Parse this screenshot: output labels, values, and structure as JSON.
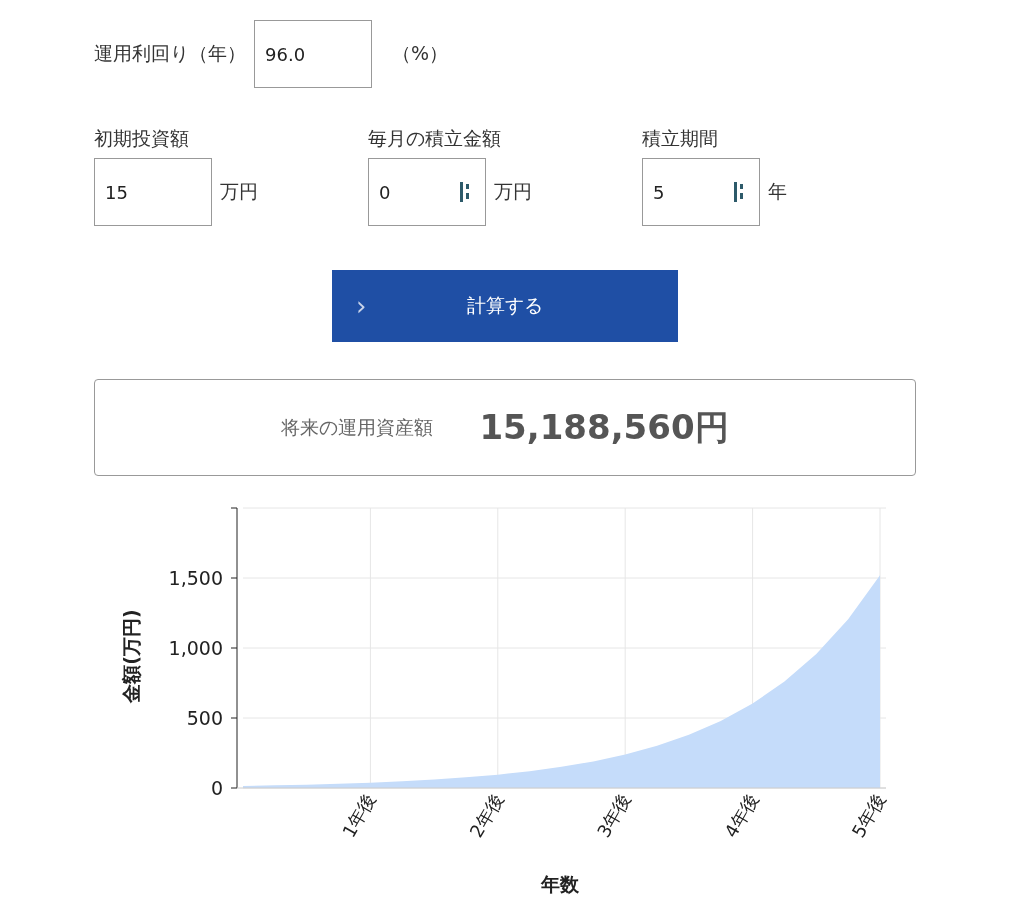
{
  "rate": {
    "label": "運用利回り（年）",
    "value": "96.0",
    "unit": "（%）"
  },
  "fields": [
    {
      "label": "初期投資額",
      "value": "15",
      "unit": "万円",
      "kind": "plain"
    },
    {
      "label": "毎月の積立金額",
      "value": "0",
      "unit": "万円",
      "kind": "spinner"
    },
    {
      "label": "積立期間",
      "value": "5",
      "unit": "年",
      "kind": "spinner"
    }
  ],
  "button": {
    "icon": "›",
    "label": "計算する"
  },
  "result": {
    "label": "将来の運用資産額",
    "value": "15,188,560円"
  },
  "chart": {
    "chart_data": {
      "type": "area",
      "xlabel": "年数",
      "ylabel": "金額(万円)",
      "x": [
        0,
        0.25,
        0.5,
        0.75,
        1,
        1.25,
        1.5,
        1.75,
        2,
        2.25,
        2.5,
        2.75,
        3,
        3.25,
        3.5,
        3.75,
        4,
        4.25,
        4.5,
        4.75,
        5
      ],
      "series": [
        {
          "color": "#c5dcfa",
          "values": [
            15,
            19,
            24,
            30,
            38,
            48,
            60,
            76,
            95,
            120,
            151,
            190,
            240,
            302,
            380,
            479,
            603,
            760,
            957,
            1206,
            1519
          ]
        }
      ],
      "grid": true,
      "xlim": [
        0,
        5
      ],
      "ylim": [
        0,
        2000
      ],
      "xticks": [
        {
          "value": 1,
          "label": "1年後"
        },
        {
          "value": 2,
          "label": "2年後"
        },
        {
          "value": 3,
          "label": "3年後"
        },
        {
          "value": 4,
          "label": "4年後"
        },
        {
          "value": 5,
          "label": "5年後"
        }
      ],
      "yticks": [
        {
          "value": 0,
          "label": "0"
        },
        {
          "value": 500,
          "label": "500"
        },
        {
          "value": 1000,
          "label": "1,000"
        },
        {
          "value": 1500,
          "label": "1,500"
        }
      ]
    }
  }
}
